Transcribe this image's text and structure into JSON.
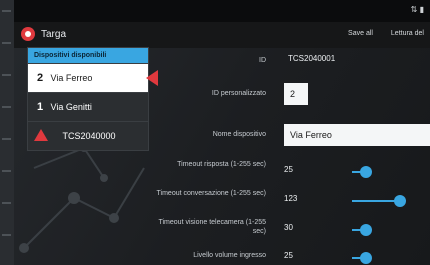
{
  "statusbar": {
    "icons": "⇅ ▮"
  },
  "actionbar": {
    "title": "Targa",
    "links": [
      "Save all",
      "Lettura del"
    ]
  },
  "devices": {
    "header": "Dispositivi disponibili",
    "items": [
      {
        "num": "2",
        "name": "Via Ferreo",
        "active": true
      },
      {
        "num": "1",
        "name": "Via Genitti",
        "active": false
      },
      {
        "num": "",
        "name": "TCS2040000",
        "warning": true
      }
    ]
  },
  "details": {
    "id_label": "ID",
    "id_value": "TCS2040001",
    "custom_id_label": "ID personalizzato",
    "custom_id_value": "2",
    "name_label": "Nome dispositivo",
    "name_value": "Via Ferreo",
    "sliders": [
      {
        "label": "Timeout risposta (1-255 sec)",
        "value": "25",
        "level": 0.08
      },
      {
        "label": "Timeout conversazione (1-255 sec)",
        "value": "123",
        "level": 0.48
      },
      {
        "label": "Timeout visione telecamera (1-255 sec)",
        "value": "30",
        "level": 0.1
      },
      {
        "label": "Livello volume ingresso",
        "value": "25",
        "level": 0.1
      }
    ]
  },
  "colors": {
    "accent": "#39a6e1",
    "alert": "#e0393e"
  }
}
